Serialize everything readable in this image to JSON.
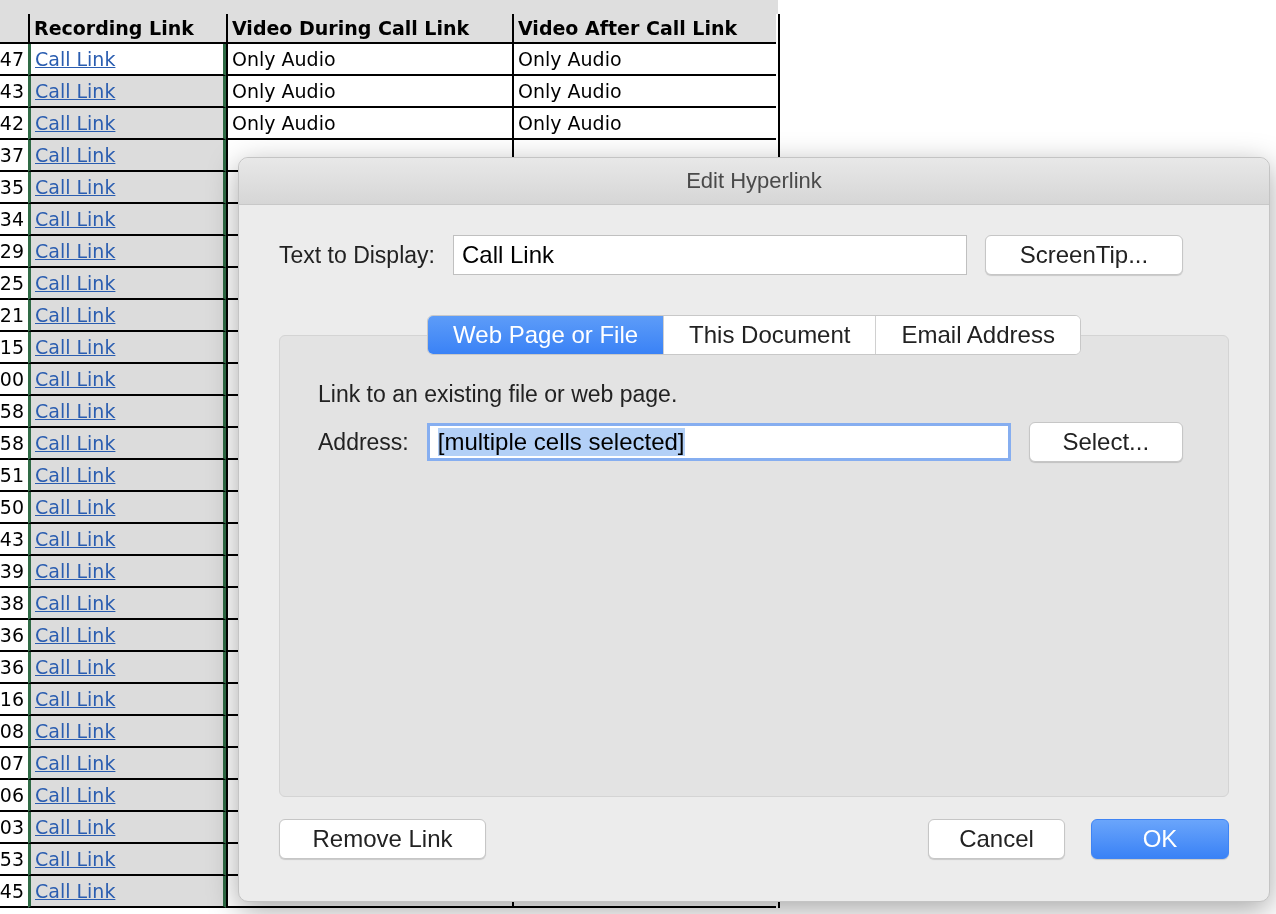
{
  "sheet": {
    "columns": [
      {},
      {
        "label": "Recording Link"
      },
      {
        "label": "Video During Call Link"
      },
      {
        "label": "Video After Call Link"
      }
    ],
    "rows": [
      {
        "column_1": "47",
        "link": "Call Link",
        "video_during": "Only Audio",
        "video_after": "Only Audio",
        "active": true
      },
      {
        "column_1": "43",
        "link": "Call Link",
        "video_during": "Only Audio",
        "video_after": "Only Audio",
        "active": false
      },
      {
        "column_1": "42",
        "link": "Call Link",
        "video_during": "Only Audio",
        "video_after": "Only Audio",
        "active": false
      },
      {
        "column_1": "37",
        "link": "Call Link",
        "active": false
      },
      {
        "column_1": "35",
        "link": "Call Link",
        "active": false
      },
      {
        "column_1": "34",
        "link": "Call Link",
        "active": false
      },
      {
        "column_1": "29",
        "link": "Call Link",
        "active": false
      },
      {
        "column_1": "25",
        "link": "Call Link",
        "active": false
      },
      {
        "column_1": "21",
        "link": "Call Link",
        "active": false
      },
      {
        "column_1": "15",
        "link": "Call Link",
        "active": false
      },
      {
        "column_1": "00",
        "link": "Call Link",
        "active": false
      },
      {
        "column_1": "58",
        "link": "Call Link",
        "active": false
      },
      {
        "column_1": "58",
        "link": "Call Link",
        "active": false
      },
      {
        "column_1": "51",
        "link": "Call Link",
        "active": false
      },
      {
        "column_1": "50",
        "link": "Call Link",
        "active": false
      },
      {
        "column_1": "43",
        "link": "Call Link",
        "active": false
      },
      {
        "column_1": "39",
        "link": "Call Link",
        "active": false
      },
      {
        "column_1": "38",
        "link": "Call Link",
        "active": false
      },
      {
        "column_1": "36",
        "link": "Call Link",
        "active": false
      },
      {
        "column_1": "36",
        "link": "Call Link",
        "active": false
      },
      {
        "column_1": "16",
        "link": "Call Link",
        "active": false
      },
      {
        "column_1": "08",
        "link": "Call Link",
        "active": false
      },
      {
        "column_1": "07",
        "link": "Call Link",
        "active": false
      },
      {
        "column_1": "06",
        "link": "Call Link",
        "active": false
      },
      {
        "column_1": "03",
        "link": "Call Link",
        "active": false
      },
      {
        "column_1": "53",
        "link": "Call Link",
        "active": false
      },
      {
        "column_1": "45",
        "link": "Call Link",
        "active": false
      }
    ]
  },
  "dialog": {
    "title": "Edit Hyperlink",
    "text_to_display": {
      "label": "Text to Display:",
      "value": "Call Link"
    },
    "screentip_button": "ScreenTip...",
    "tabs": [
      {
        "label": "Web Page or File",
        "selected": true
      },
      {
        "label": "This Document",
        "selected": false
      },
      {
        "label": "Email Address",
        "selected": false
      }
    ],
    "description": "Link to an existing file or web page.",
    "address": {
      "label": "Address:",
      "value": "[multiple cells selected]",
      "value_selected": true
    },
    "select_button": "Select...",
    "remove_button": "Remove Link",
    "cancel_button": "Cancel",
    "ok_button": {
      "label": "OK",
      "default": true
    }
  }
}
